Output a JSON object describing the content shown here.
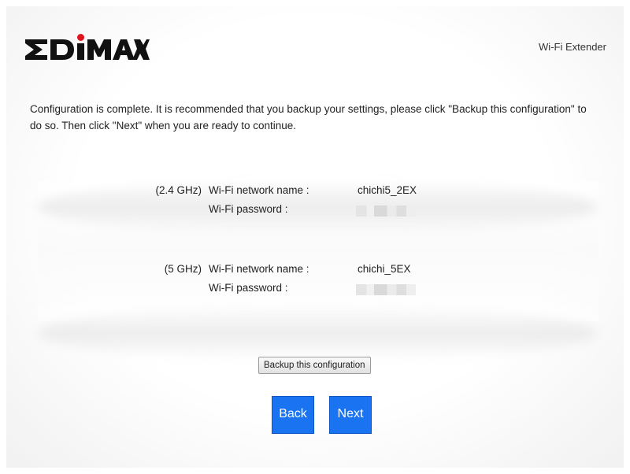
{
  "header": {
    "brand_logo_text": "EDIMAX",
    "product_label": "Wi-Fi Extender"
  },
  "message": "Configuration is complete. It is recommended that you backup your settings, please click \"Backup this configuration\" to do so. Then click \"Next\" when you are ready to continue.",
  "networks": [
    {
      "band": "(2.4 GHz)",
      "name_label": "Wi-Fi network name :",
      "name_value": "chichi5_2EX",
      "password_label": "Wi-Fi password :"
    },
    {
      "band": "(5 GHz)",
      "name_label": "Wi-Fi network name :",
      "name_value": "chichi_5EX",
      "password_label": "Wi-Fi password :"
    }
  ],
  "buttons": {
    "backup": "Backup this configuration",
    "back": "Back",
    "next": "Next"
  },
  "colors": {
    "primary_button": "#1a73f0",
    "logo_dot": "#e0141e",
    "logo_text": "#111111"
  }
}
